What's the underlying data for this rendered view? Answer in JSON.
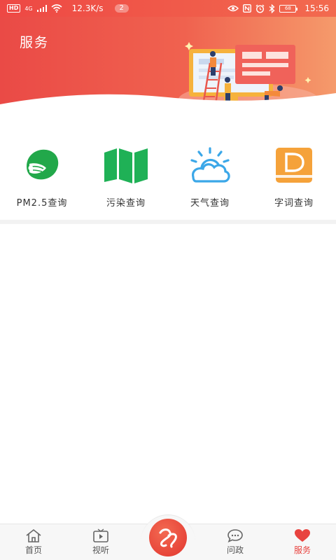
{
  "status_bar": {
    "hd": "HD",
    "network": "4G",
    "speed": "12.3K/s",
    "notification_count": "2",
    "battery": "68",
    "time": "15:56"
  },
  "header": {
    "title": "服务"
  },
  "services": [
    {
      "label": "PM2.5查询",
      "icon": "mask-icon",
      "color": "#22a84a"
    },
    {
      "label": "污染查询",
      "icon": "map-icon",
      "color": "#1fb156"
    },
    {
      "label": "天气查询",
      "icon": "weather-icon",
      "color": "#3ba7e8"
    },
    {
      "label": "字词查询",
      "icon": "dictionary-icon",
      "color": "#f5a23a"
    }
  ],
  "bottom_nav": {
    "home": "首页",
    "video": "视听",
    "politics": "问政",
    "service": "服务",
    "active": "service"
  },
  "colors": {
    "brand_red": "#e8433f",
    "header_gradient_start": "#ea4a46",
    "header_gradient_end": "#f59a6b"
  }
}
